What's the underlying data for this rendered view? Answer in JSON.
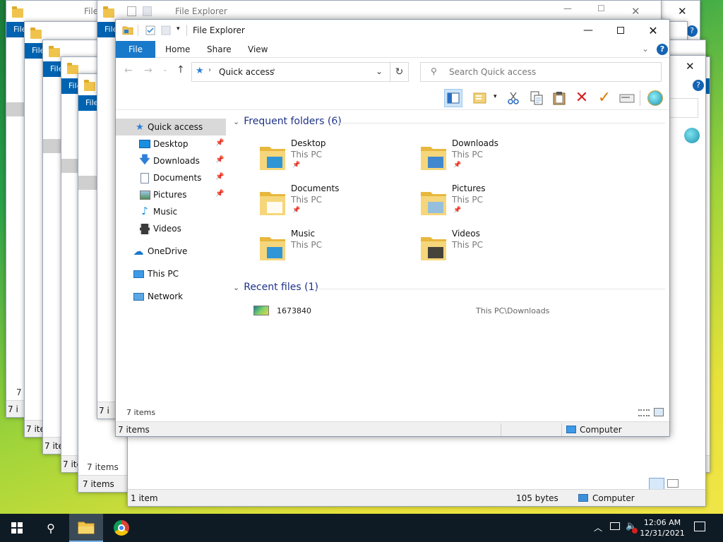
{
  "window": {
    "title": "File Explorer",
    "ribbon_tabs": [
      "File",
      "Home",
      "Share",
      "View"
    ],
    "help_label": "?"
  },
  "address": {
    "path_root": "Quick access",
    "search_placeholder": "Search Quick access"
  },
  "nav": {
    "quick_access": "Quick access",
    "items": [
      "Desktop",
      "Downloads",
      "Documents",
      "Pictures",
      "Music",
      "Videos"
    ],
    "onedrive": "OneDrive",
    "this_pc": "This PC",
    "network": "Network"
  },
  "frequent": {
    "header": "Frequent folders (6)",
    "folders": [
      {
        "name": "Desktop",
        "location": "This PC",
        "pinned": true
      },
      {
        "name": "Downloads",
        "location": "This PC",
        "pinned": true
      },
      {
        "name": "Documents",
        "location": "This PC",
        "pinned": true
      },
      {
        "name": "Pictures",
        "location": "This PC",
        "pinned": true
      },
      {
        "name": "Music",
        "location": "This PC",
        "pinned": false
      },
      {
        "name": "Videos",
        "location": "This PC",
        "pinned": false
      }
    ]
  },
  "recent": {
    "header": "Recent files (1)",
    "files": [
      {
        "name": "1673840",
        "path": "This PC\\Downloads"
      }
    ]
  },
  "status": {
    "items_inner": "7 items",
    "items_outer": "7 items",
    "computer": "Computer"
  },
  "background_windows": {
    "title_short": "File",
    "title_full": "File Explorer",
    "file_tab": "File",
    "items_short": "7 i",
    "items_med": "7 ite",
    "items": "7 items",
    "one_item": "1 item",
    "bytes": "105 bytes",
    "computer": "Computer",
    "computer_cut": "puter",
    "help_label": "?"
  },
  "taskbar": {
    "time": "12:06 AM",
    "date": "12/31/2021"
  },
  "colors": {
    "ribbon_blue": "#1979ca",
    "header_blue": "#1e3287",
    "folder_yellow": "#f0c44c",
    "taskbar": "#0f1b24",
    "delete_red": "#d61f1f",
    "check_orange": "#e07b00"
  }
}
